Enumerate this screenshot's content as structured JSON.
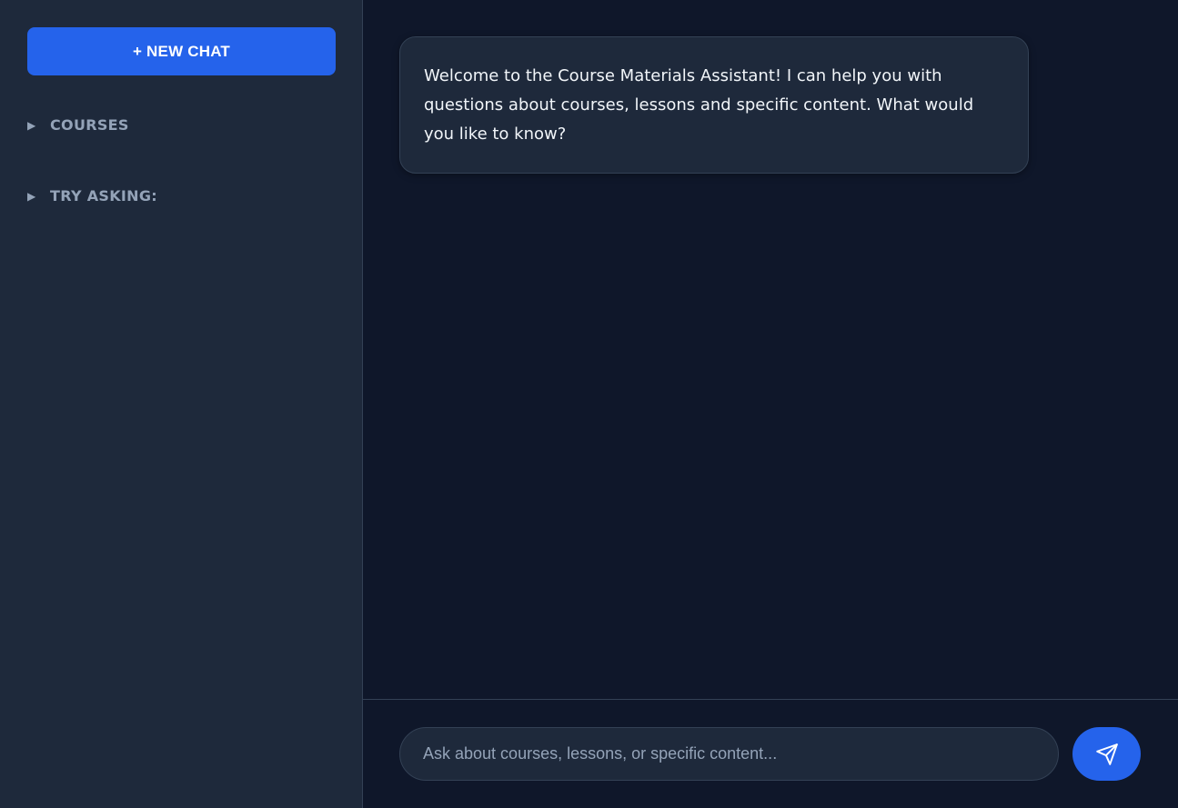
{
  "sidebar": {
    "new_chat_label": "+ NEW CHAT",
    "sections": [
      {
        "label": "COURSES",
        "icon": "triangle-right-icon"
      },
      {
        "label": "TRY ASKING:",
        "icon": "triangle-right-icon"
      }
    ]
  },
  "chat": {
    "messages": [
      {
        "role": "assistant",
        "text": "Welcome to the Course Materials Assistant! I can help you with questions about courses, lessons and specific content. What would you like to know?"
      }
    ]
  },
  "input": {
    "placeholder": "Ask about courses, lessons, or specific content...",
    "value": "",
    "send_icon": "paper-plane-icon"
  },
  "colors": {
    "accent": "#2563eb",
    "sidebar_bg": "#1e293b",
    "main_bg": "#0f172a",
    "border": "#334155",
    "muted_text": "#94a3b8",
    "text": "#f1f5f9"
  }
}
